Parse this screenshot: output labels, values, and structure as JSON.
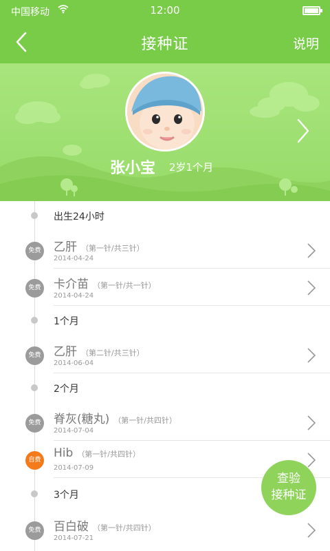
{
  "status_bar": {
    "carrier": "中国移动",
    "time": "12:00"
  },
  "navbar": {
    "title": "接种证",
    "help_label": "说明"
  },
  "profile": {
    "name": "张小宝",
    "age": "2岁1个月"
  },
  "schedule": {
    "groups": [
      {
        "label": "出生24小时",
        "items": [
          {
            "badge": "免费",
            "name": "乙肝",
            "dose": "（第一针/共三针）",
            "date": "2014-04-24"
          },
          {
            "badge": "免费",
            "name": "卡介苗",
            "dose": "（第一针/共一针）",
            "date": "2014-04-24"
          }
        ]
      },
      {
        "label": "1个月",
        "items": [
          {
            "badge": "免费",
            "name": "乙肝",
            "dose": "（第二针/共三针）",
            "date": "2014-06-04"
          }
        ]
      },
      {
        "label": "2个月",
        "items": [
          {
            "badge": "免费",
            "name": "脊灰(糖丸)",
            "dose": "（第一针/共四针）",
            "date": "2014-07-04"
          },
          {
            "badge": "自费",
            "name": "Hib",
            "dose": "（第一针/共四针）",
            "date": "2014-07-09"
          }
        ]
      },
      {
        "label": "3个月",
        "items": [
          {
            "badge": "免费",
            "name": "百白破",
            "dose": "（第一针/共四针）",
            "date": "2014-07-21"
          }
        ]
      }
    ]
  },
  "fab": {
    "line1": "查验",
    "line2": "接种证"
  },
  "colors": {
    "primary": "#78cc48",
    "banner": "#a8e57d",
    "free_badge": "#9b9b9b",
    "paid_badge": "#f47a1a"
  }
}
